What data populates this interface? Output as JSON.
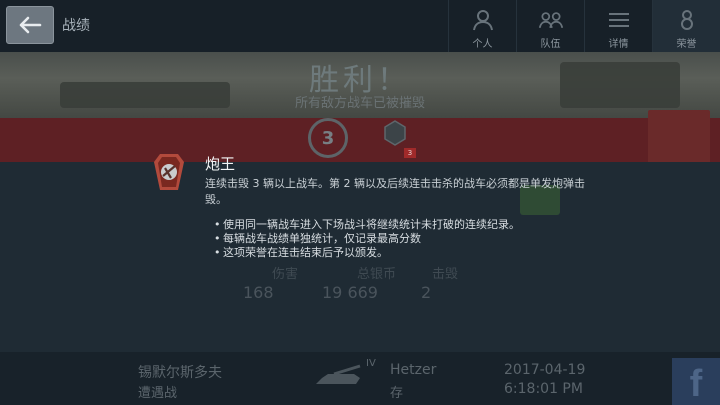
{
  "header": {
    "title": "战绩",
    "tabs": [
      {
        "label": "个人",
        "icon": "person-icon"
      },
      {
        "label": "队伍",
        "icon": "team-icon"
      },
      {
        "label": "详情",
        "icon": "details-icon"
      },
      {
        "label": "荣誉",
        "icon": "honor-icon"
      }
    ]
  },
  "result": {
    "title": "胜利！",
    "subtitle": "所有敌方战车已被摧毁",
    "medal_value": "3",
    "badge_value": "3"
  },
  "stats": [
    {
      "label": "伤害",
      "value": "168"
    },
    {
      "label": "总银币",
      "value": "19 669"
    },
    {
      "label": "击毁",
      "value": "2"
    }
  ],
  "tooltip": {
    "title": "炮王",
    "description": "连续击毁 3 辆以上战车。第 2 辆以及后续连击击杀的战车必须都是单发炮弹击毁。",
    "rules": [
      "使用同一辆战车进入下场战斗将继续统计未打破的连续纪录。",
      "每辆战车战绩单独统计，仅记录最高分数",
      "这项荣誉在连击结束后予以颁发。"
    ]
  },
  "footer": {
    "map_name": "锡默尔斯多夫",
    "battle_type": "遭遇战",
    "tank_tier": "IV",
    "tank_name": "Hetzer",
    "tank_status": "存",
    "date": "2017-04-19",
    "time": "6:18:01 PM",
    "share_label": "f"
  },
  "colors": {
    "banner_red": "#5e2024",
    "background": "#1e2a33",
    "facebook": "#2a3e5c"
  }
}
